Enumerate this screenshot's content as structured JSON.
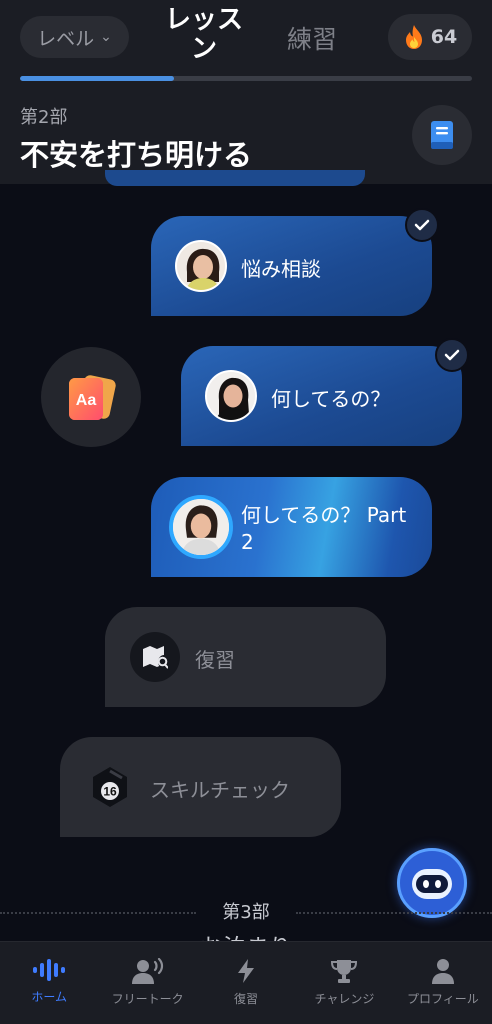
{
  "header": {
    "level_label": "レベル",
    "tab_lesson_line1": "レッス",
    "tab_lesson_line2": "ン",
    "tab_practice": "練習",
    "streak_count": "64",
    "progress": 0.34,
    "section_label": "第2部",
    "section_title": "不安を打ち明ける"
  },
  "lessons": [
    {
      "label": "悩み相談",
      "completed": true
    },
    {
      "label": "何してるの？",
      "completed": true
    },
    {
      "label_line1": "何してるの？ Part",
      "label_line2": "2",
      "completed": false,
      "current": true
    }
  ],
  "review": {
    "label": "復習"
  },
  "skill_check": {
    "label": "スキルチェック",
    "badge": "16"
  },
  "next_section": {
    "label": "第3部",
    "title": "お泊まり"
  },
  "nav": [
    {
      "label": "ホーム",
      "icon": "voice-wave-icon",
      "active": true
    },
    {
      "label": "フリートーク",
      "icon": "speaking-person-icon"
    },
    {
      "label": "復習",
      "icon": "lightning-icon"
    },
    {
      "label": "チャレンジ",
      "icon": "trophy-icon"
    },
    {
      "label": "プロフィール",
      "icon": "person-icon"
    }
  ],
  "colors": {
    "accent": "#3f7cff",
    "lesson_card": "#1c4a92",
    "background": "#0b0d16",
    "streak_flame": "#ff7a1a"
  }
}
